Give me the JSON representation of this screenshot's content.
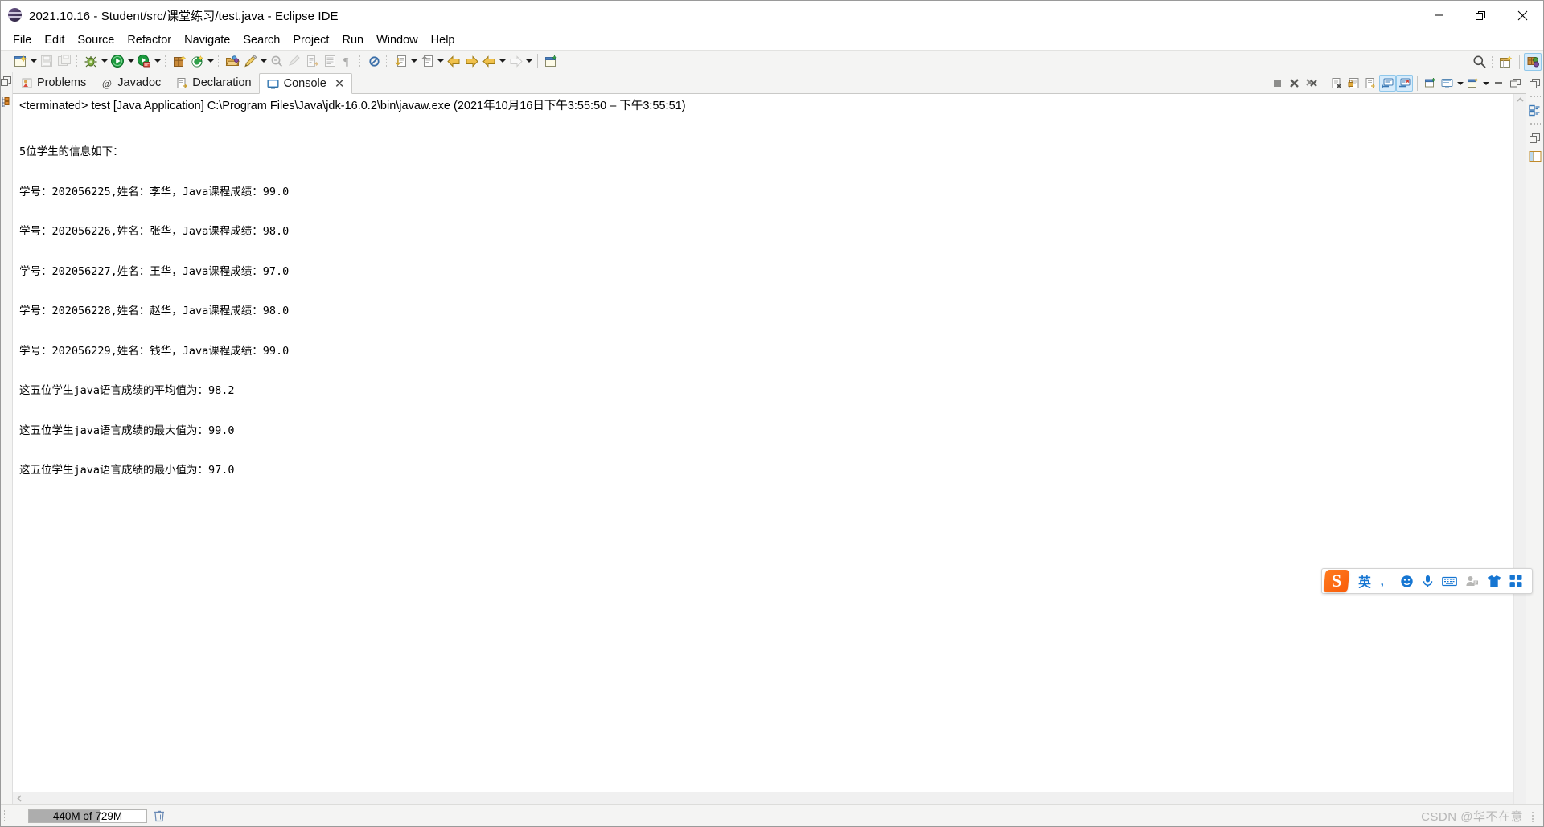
{
  "window": {
    "title": "2021.10.16 - Student/src/课堂练习/test.java - Eclipse IDE",
    "app_icon": "eclipse-globe-icon",
    "controls": {
      "minimize": "minimize-button",
      "restore": "restore-button",
      "close": "close-button"
    }
  },
  "menubar": {
    "items": [
      {
        "label": "File"
      },
      {
        "label": "Edit"
      },
      {
        "label": "Source"
      },
      {
        "label": "Refactor"
      },
      {
        "label": "Navigate"
      },
      {
        "label": "Search"
      },
      {
        "label": "Project"
      },
      {
        "label": "Run"
      },
      {
        "label": "Window"
      },
      {
        "label": "Help"
      }
    ]
  },
  "toolbar": {
    "groups": [
      {
        "icons": [
          "new-wizard-icon",
          "dropdown-caret",
          "save-icon",
          "save-all-icon"
        ]
      },
      {
        "icons": [
          "debug-icon",
          "dropdown-caret",
          "run-icon",
          "dropdown-caret",
          "run-coverage-icon",
          "dropdown-caret"
        ]
      },
      {
        "icons": [
          "new-java-package-icon",
          "new-java-class-icon",
          "dropdown-caret"
        ]
      },
      {
        "icons": [
          "open-type-icon",
          "external-tools-icon",
          "dropdown-caret",
          "search-declaration-icon"
        ]
      },
      {
        "icons": [
          "marker-icon",
          "next-annotation-icon",
          "previous-annotation-icon",
          "toggle-mark-occurrences-icon"
        ]
      },
      {
        "icons": [
          "skip-breakpoints-icon"
        ]
      },
      {
        "icons": [
          "previous-edit-icon",
          "dropdown-caret",
          "next-edit-icon",
          "dropdown-caret"
        ]
      },
      {
        "icons": [
          "back-icon",
          "forward-icon",
          "back-history-icon",
          "dropdown-caret",
          "forward-history-icon",
          "dropdown-caret"
        ]
      },
      {
        "icons": [
          "new-window-icon"
        ]
      }
    ],
    "right_icons": [
      "search-icon",
      "open-perspective-icon",
      "java-perspective-icon"
    ],
    "java_perspective_active": true
  },
  "left_rail": {
    "icons": [
      "restore-view-icon",
      "outline-view-icon"
    ]
  },
  "views": {
    "tabs": [
      {
        "label": "Problems",
        "icon": "problems-icon",
        "active": false,
        "closable": false
      },
      {
        "label": "Javadoc",
        "icon": "javadoc-at-icon",
        "active": false,
        "closable": false
      },
      {
        "label": "Declaration",
        "icon": "declaration-icon",
        "active": false,
        "closable": false
      },
      {
        "label": "Console",
        "icon": "console-icon",
        "active": true,
        "closable": true,
        "close_label": "✕"
      }
    ],
    "view_toolbar": [
      {
        "name": "terminate-icon",
        "toggled": false
      },
      {
        "name": "remove-launch-icon",
        "toggled": false
      },
      {
        "name": "remove-all-terminated-icon",
        "toggled": false
      },
      {
        "name": "clear-console-icon",
        "toggled": false
      },
      {
        "name": "scroll-lock-icon",
        "toggled": false
      },
      {
        "name": "word-wrap-icon",
        "toggled": false
      },
      {
        "name": "show-console-on-output-icon",
        "toggled": true
      },
      {
        "name": "show-console-on-error-icon",
        "toggled": true
      },
      {
        "name": "pin-console-icon",
        "toggled": false
      },
      {
        "name": "display-selected-console-icon",
        "toggled": false
      },
      {
        "name": "dropdown-caret",
        "toggled": false
      },
      {
        "name": "open-console-icon",
        "toggled": false
      },
      {
        "name": "dropdown-caret-2",
        "toggled": false
      },
      {
        "name": "minimize-view-icon",
        "toggled": false
      },
      {
        "name": "maximize-view-icon",
        "toggled": false
      }
    ]
  },
  "console": {
    "terminated_line": "<terminated> test [Java Application] C:\\Program Files\\Java\\jdk-16.0.2\\bin\\javaw.exe  (2021年10月16日下午3:55:50 – 下午3:55:51)",
    "output_lines": [
      "5位学生的信息如下：",
      "学号：202056225,姓名：李华，Java课程成绩：99.0",
      "学号：202056226,姓名：张华，Java课程成绩：98.0",
      "学号：202056227,姓名：王华，Java课程成绩：97.0",
      "学号：202056228,姓名：赵华，Java课程成绩：98.0",
      "学号：202056229,姓名：钱华，Java课程成绩：99.0",
      "这五位学生java语言成绩的平均值为：98.2",
      "这五位学生java语言成绩的最大值为：99.0",
      "这五位学生java语言成绩的最小值为：97.0"
    ],
    "scrollbars": {
      "vertical_up_arrow": "scroll-up-arrow",
      "horizontal_left_arrow": "scroll-left-arrow"
    }
  },
  "right_rail": {
    "icons": [
      "restore-icon",
      "outline-structure-icon",
      "restore-2-icon",
      "package-explorer-icon"
    ]
  },
  "statusbar": {
    "heap_text": "440M of 729M",
    "heap_used_percent": 60,
    "trash_icon": "trash-icon",
    "watermark": "CSDN @华不在意"
  },
  "ime": {
    "logo_letter": "S",
    "items": [
      {
        "name": "language-toggle",
        "glyph": "英"
      },
      {
        "name": "punctuation-toggle",
        "glyph": "，"
      },
      {
        "name": "emoji-icon",
        "glyph": "☺"
      },
      {
        "name": "voice-input-icon",
        "glyph": "mic"
      },
      {
        "name": "soft-keyboard-icon",
        "glyph": "keyboard"
      },
      {
        "name": "user-account-icon",
        "glyph": "user"
      },
      {
        "name": "skin-icon",
        "glyph": "shirt"
      },
      {
        "name": "toolbox-icon",
        "glyph": "grid"
      }
    ]
  },
  "colors": {
    "accent_blue": "#1676d2",
    "toggle_blue": "#d6ebfb",
    "ime_orange": "#f95d0a",
    "chrome_gray": "#f4f4f3"
  }
}
